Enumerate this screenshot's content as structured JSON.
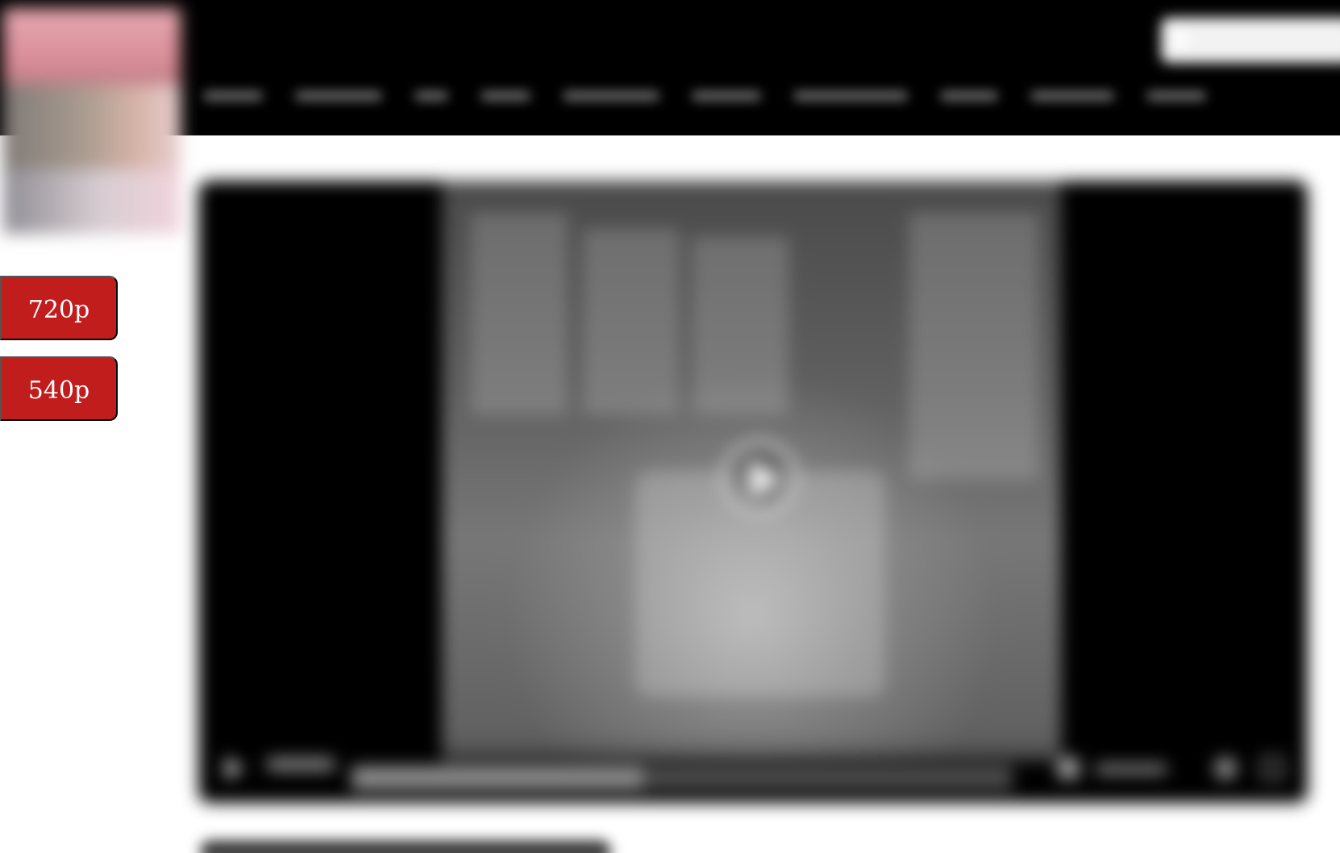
{
  "header": {
    "site_title": "",
    "search": {
      "placeholder": ""
    },
    "nav_items": [
      {
        "label": ""
      },
      {
        "label": ""
      },
      {
        "label": ""
      },
      {
        "label": ""
      },
      {
        "label": ""
      },
      {
        "label": ""
      },
      {
        "label": ""
      },
      {
        "label": ""
      },
      {
        "label": ""
      },
      {
        "label": ""
      }
    ]
  },
  "sidebar": {
    "quality_buttons": [
      {
        "label": "720p"
      },
      {
        "label": "540p"
      }
    ]
  },
  "player": {
    "progress": 0.44,
    "current_time": "",
    "duration": ""
  },
  "content": {
    "video_title": ""
  },
  "colors": {
    "header_background": "#000000",
    "button_red": "#c21d1d",
    "page_background": "#ffffff"
  },
  "icons": {
    "search": "search-icon",
    "play": "play-icon",
    "volume": "volume-icon",
    "settings": "settings-icon",
    "fullscreen": "fullscreen-icon"
  }
}
